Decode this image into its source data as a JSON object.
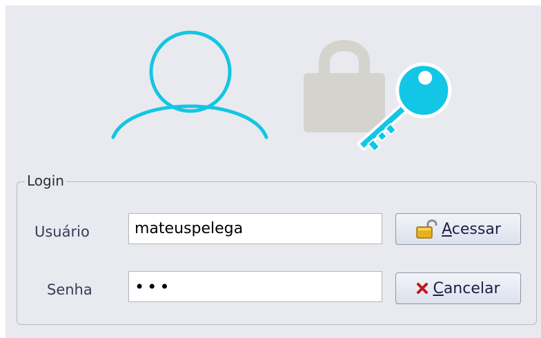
{
  "header": {
    "icons": [
      "user-icon",
      "lock-key-icon"
    ],
    "colors": {
      "user_icon": "#14c5e3",
      "lock_icon": "#d5d3ce",
      "key_icon": "#12c6e6"
    }
  },
  "login_group": {
    "title": "Login",
    "username": {
      "label": "Usuário",
      "value": "mateuspelega"
    },
    "password": {
      "label": "Senha",
      "masked_value": "•••"
    },
    "access_button": {
      "mnemonic": "A",
      "rest": "cessar",
      "icon": "open-padlock-icon"
    },
    "cancel_button": {
      "mnemonic": "C",
      "rest": "ancelar",
      "icon": "red-x-icon"
    }
  }
}
